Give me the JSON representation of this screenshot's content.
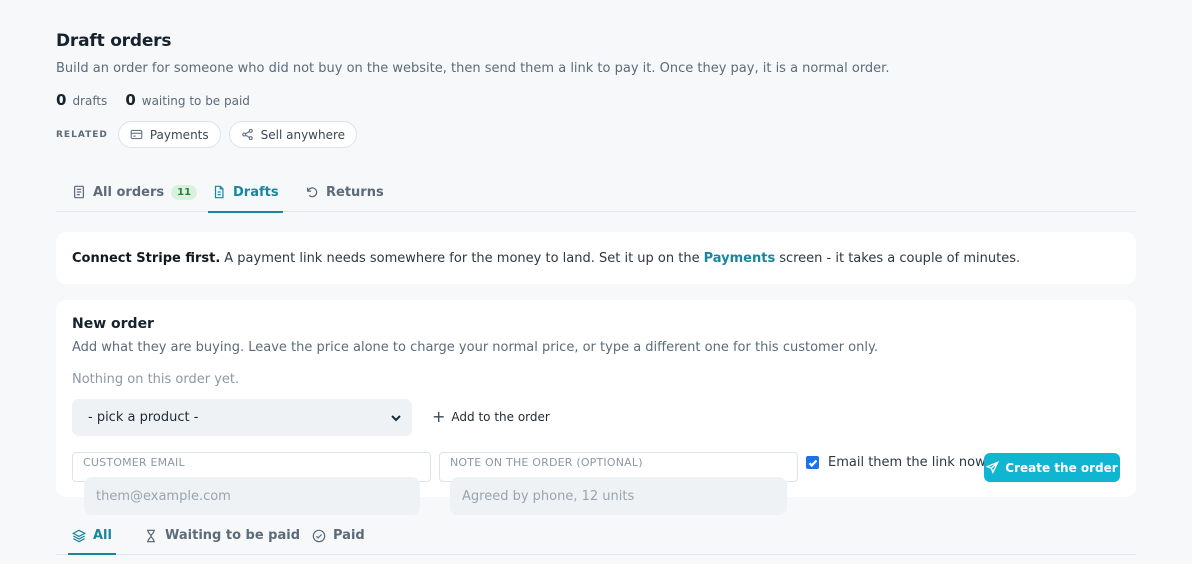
{
  "header": {
    "title": "Draft orders",
    "subtitle": "Build an order for someone who did not buy on the website, then send them a link to pay it. Once they pay, it is a normal order."
  },
  "stats": [
    {
      "value": "0",
      "label": "drafts"
    },
    {
      "value": "0",
      "label": "waiting to be paid"
    }
  ],
  "related": {
    "label": "RELATED",
    "links": [
      {
        "label": "Payments",
        "icon": "credit-card-icon"
      },
      {
        "label": "Sell anywhere",
        "icon": "share-icon"
      }
    ]
  },
  "tabs": [
    {
      "label": "All orders",
      "badge": "11",
      "icon": "receipt-icon"
    },
    {
      "label": "Drafts",
      "icon": "draft-document-icon",
      "active": true
    },
    {
      "label": "Returns",
      "icon": "undo-icon"
    }
  ],
  "notice": {
    "bold": "Connect Stripe first.",
    "text_before": "A payment link needs somewhere for the money to land. Set it up on the",
    "link": "Payments",
    "text_after": "screen - it takes a couple of minutes."
  },
  "new_order": {
    "title": "New order",
    "description": "Add what they are buying. Leave the price alone to charge your normal price, or type a different one for this customer only.",
    "empty_text": "Nothing on this order yet.",
    "product_select": "- pick a product -",
    "add_label": "Add to the order",
    "email_label": "CUSTOMER EMAIL",
    "email_placeholder": "them@example.com",
    "note_label": "NOTE ON THE ORDER (OPTIONAL)",
    "note_placeholder": "Agreed by phone, 12 units",
    "email_checkbox_label": "Email them the link now",
    "email_checkbox_checked": true,
    "create_label": "Create the order"
  },
  "filter_tabs": [
    {
      "label": "All",
      "icon": "layers-icon",
      "active": true
    },
    {
      "label": "Waiting to be paid",
      "icon": "hourglass-icon"
    },
    {
      "label": "Paid",
      "icon": "check-circle-icon"
    }
  ],
  "colors": {
    "accent": "#17869e",
    "button": "#10b5d2",
    "background": "#f6f8fa",
    "badge_bg": "#d9f2de",
    "badge_text": "#27853d"
  }
}
